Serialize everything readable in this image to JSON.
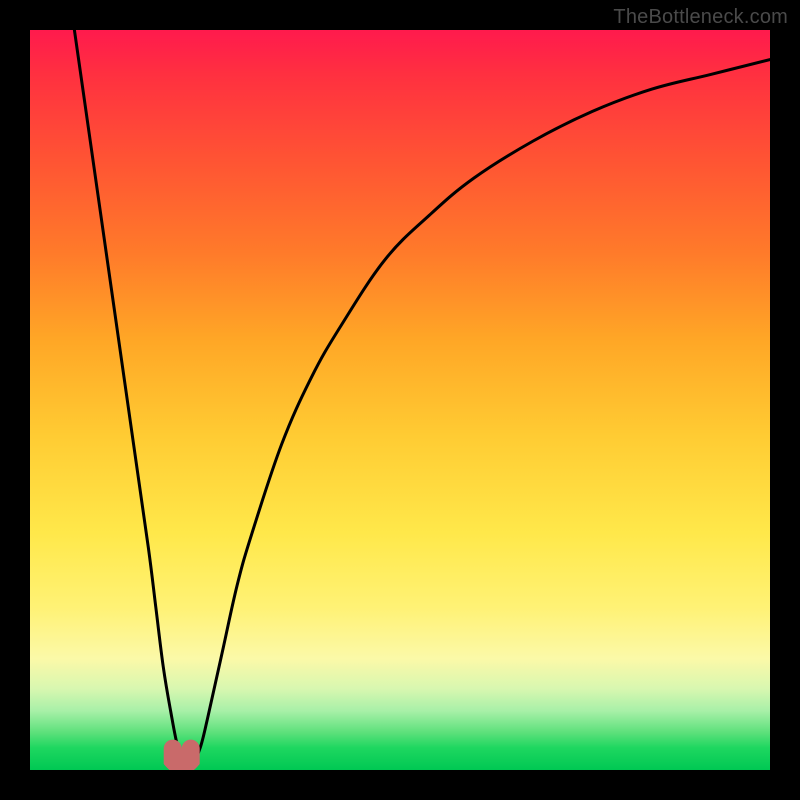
{
  "watermark": {
    "text": "TheBottleneck.com"
  },
  "chart_data": {
    "type": "line",
    "title": "",
    "xlabel": "",
    "ylabel": "",
    "xlim": [
      0,
      100
    ],
    "ylim": [
      0,
      100
    ],
    "series": [
      {
        "name": "bottleneck-curve",
        "x": [
          6,
          8,
          10,
          12,
          14,
          16,
          17,
          18,
          19,
          20,
          21,
          22,
          23,
          24,
          26,
          28,
          30,
          34,
          38,
          42,
          48,
          54,
          60,
          68,
          76,
          84,
          92,
          100
        ],
        "y": [
          100,
          86,
          72,
          58,
          44,
          30,
          22,
          14,
          8,
          3,
          1,
          1,
          3,
          7,
          16,
          25,
          32,
          44,
          53,
          60,
          69,
          75,
          80,
          85,
          89,
          92,
          94,
          96
        ]
      }
    ],
    "marker": {
      "name": "optimal-point",
      "x": 20.5,
      "y": 1,
      "color": "#c96a6a"
    },
    "gradient_stops": [
      {
        "pos": 0,
        "color": "#ff1a4d"
      },
      {
        "pos": 55,
        "color": "#ffcc33"
      },
      {
        "pos": 85,
        "color": "#fbf9a8"
      },
      {
        "pos": 100,
        "color": "#00c853"
      }
    ]
  }
}
